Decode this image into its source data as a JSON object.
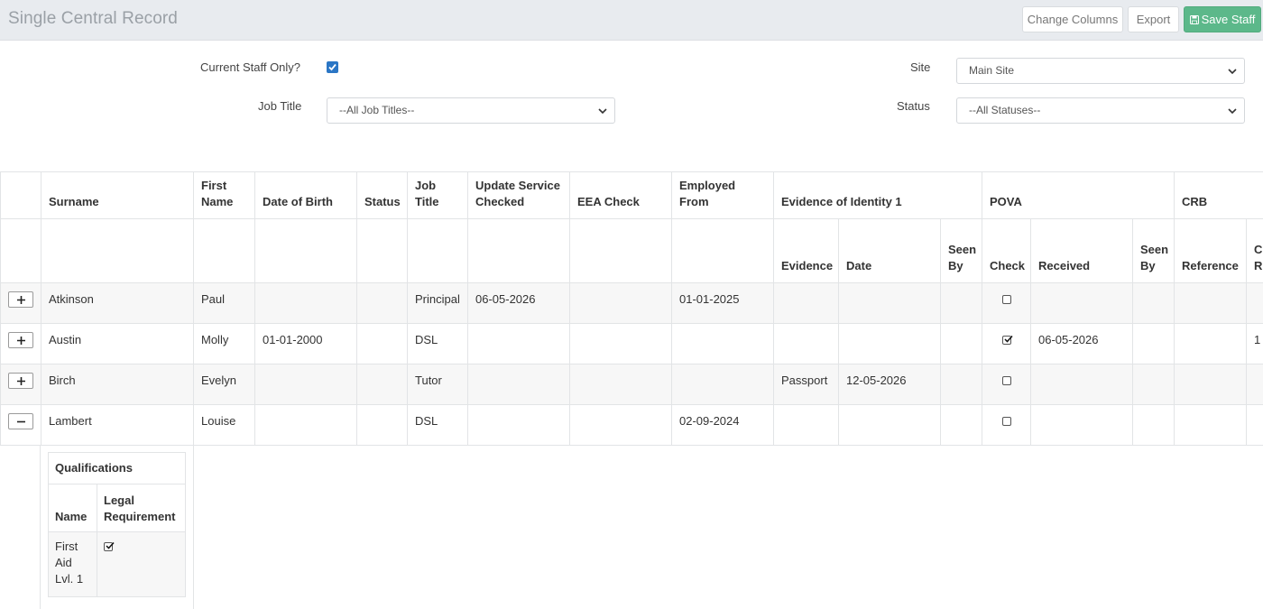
{
  "header": {
    "title": "Single Central Record",
    "change_columns": "Change Columns",
    "export": "Export",
    "save_staff": "Save Staff",
    "save_color": "#5cb88a"
  },
  "filters": {
    "current_staff_label": "Current Staff Only?",
    "current_staff_checked": true,
    "job_title_label": "Job Title",
    "job_title_value": "--All Job Titles--",
    "site_label": "Site",
    "site_value": "Main Site",
    "status_label": "Status",
    "status_value": "--All Statuses--"
  },
  "table": {
    "group_headers": [
      "Surname",
      "First Name",
      "Date of Birth",
      "Status",
      "Job Title",
      "Update Service Checked",
      "EEA Check",
      "Employed From",
      "Evidence of Identity 1",
      "POVA",
      "CRB"
    ],
    "sub_headers": {
      "evidence": "Evidence",
      "date": "Date",
      "seen_by": "Seen By",
      "check": "Check",
      "received": "Received",
      "seen_by_2": "Seen By",
      "reference": "Reference",
      "partial": "C R"
    },
    "rows": [
      {
        "toggle": "plus",
        "surname": "Atkinson",
        "first_name": "Paul",
        "dob": "",
        "status": "",
        "job_title": "Principal",
        "update_service": "06-05-2026",
        "eea": "",
        "employed_from": "01-01-2025",
        "evidence": "",
        "date": "",
        "seen_by": "",
        "pova_check": false,
        "received": "",
        "seen_by_2": "",
        "reference": "",
        "partial": ""
      },
      {
        "toggle": "plus",
        "surname": "Austin",
        "first_name": "Molly",
        "dob": "01-01-2000",
        "status": "",
        "job_title": "DSL",
        "update_service": "",
        "eea": "",
        "employed_from": "",
        "evidence": "",
        "date": "",
        "seen_by": "",
        "pova_check": true,
        "received": "06-05-2026",
        "seen_by_2": "",
        "reference": "",
        "partial": "1"
      },
      {
        "toggle": "plus",
        "surname": "Birch",
        "first_name": "Evelyn",
        "dob": "",
        "status": "",
        "job_title": "Tutor",
        "update_service": "",
        "eea": "",
        "employed_from": "",
        "evidence": "Passport",
        "date": "12-05-2026",
        "seen_by": "",
        "pova_check": false,
        "received": "",
        "seen_by_2": "",
        "reference": "",
        "partial": ""
      },
      {
        "toggle": "minus",
        "surname": "Lambert",
        "first_name": "Louise",
        "dob": "",
        "status": "",
        "job_title": "DSL",
        "update_service": "",
        "eea": "",
        "employed_from": "02-09-2024",
        "evidence": "",
        "date": "",
        "seen_by": "",
        "pova_check": false,
        "received": "",
        "seen_by_2": "",
        "reference": "",
        "partial": ""
      }
    ]
  },
  "qualifications": {
    "title": "Qualifications",
    "col_name": "Name",
    "col_legal": "Legal Requirement",
    "rows": [
      {
        "name": "First Aid Lvl. 1",
        "legal_requirement": true
      }
    ]
  }
}
